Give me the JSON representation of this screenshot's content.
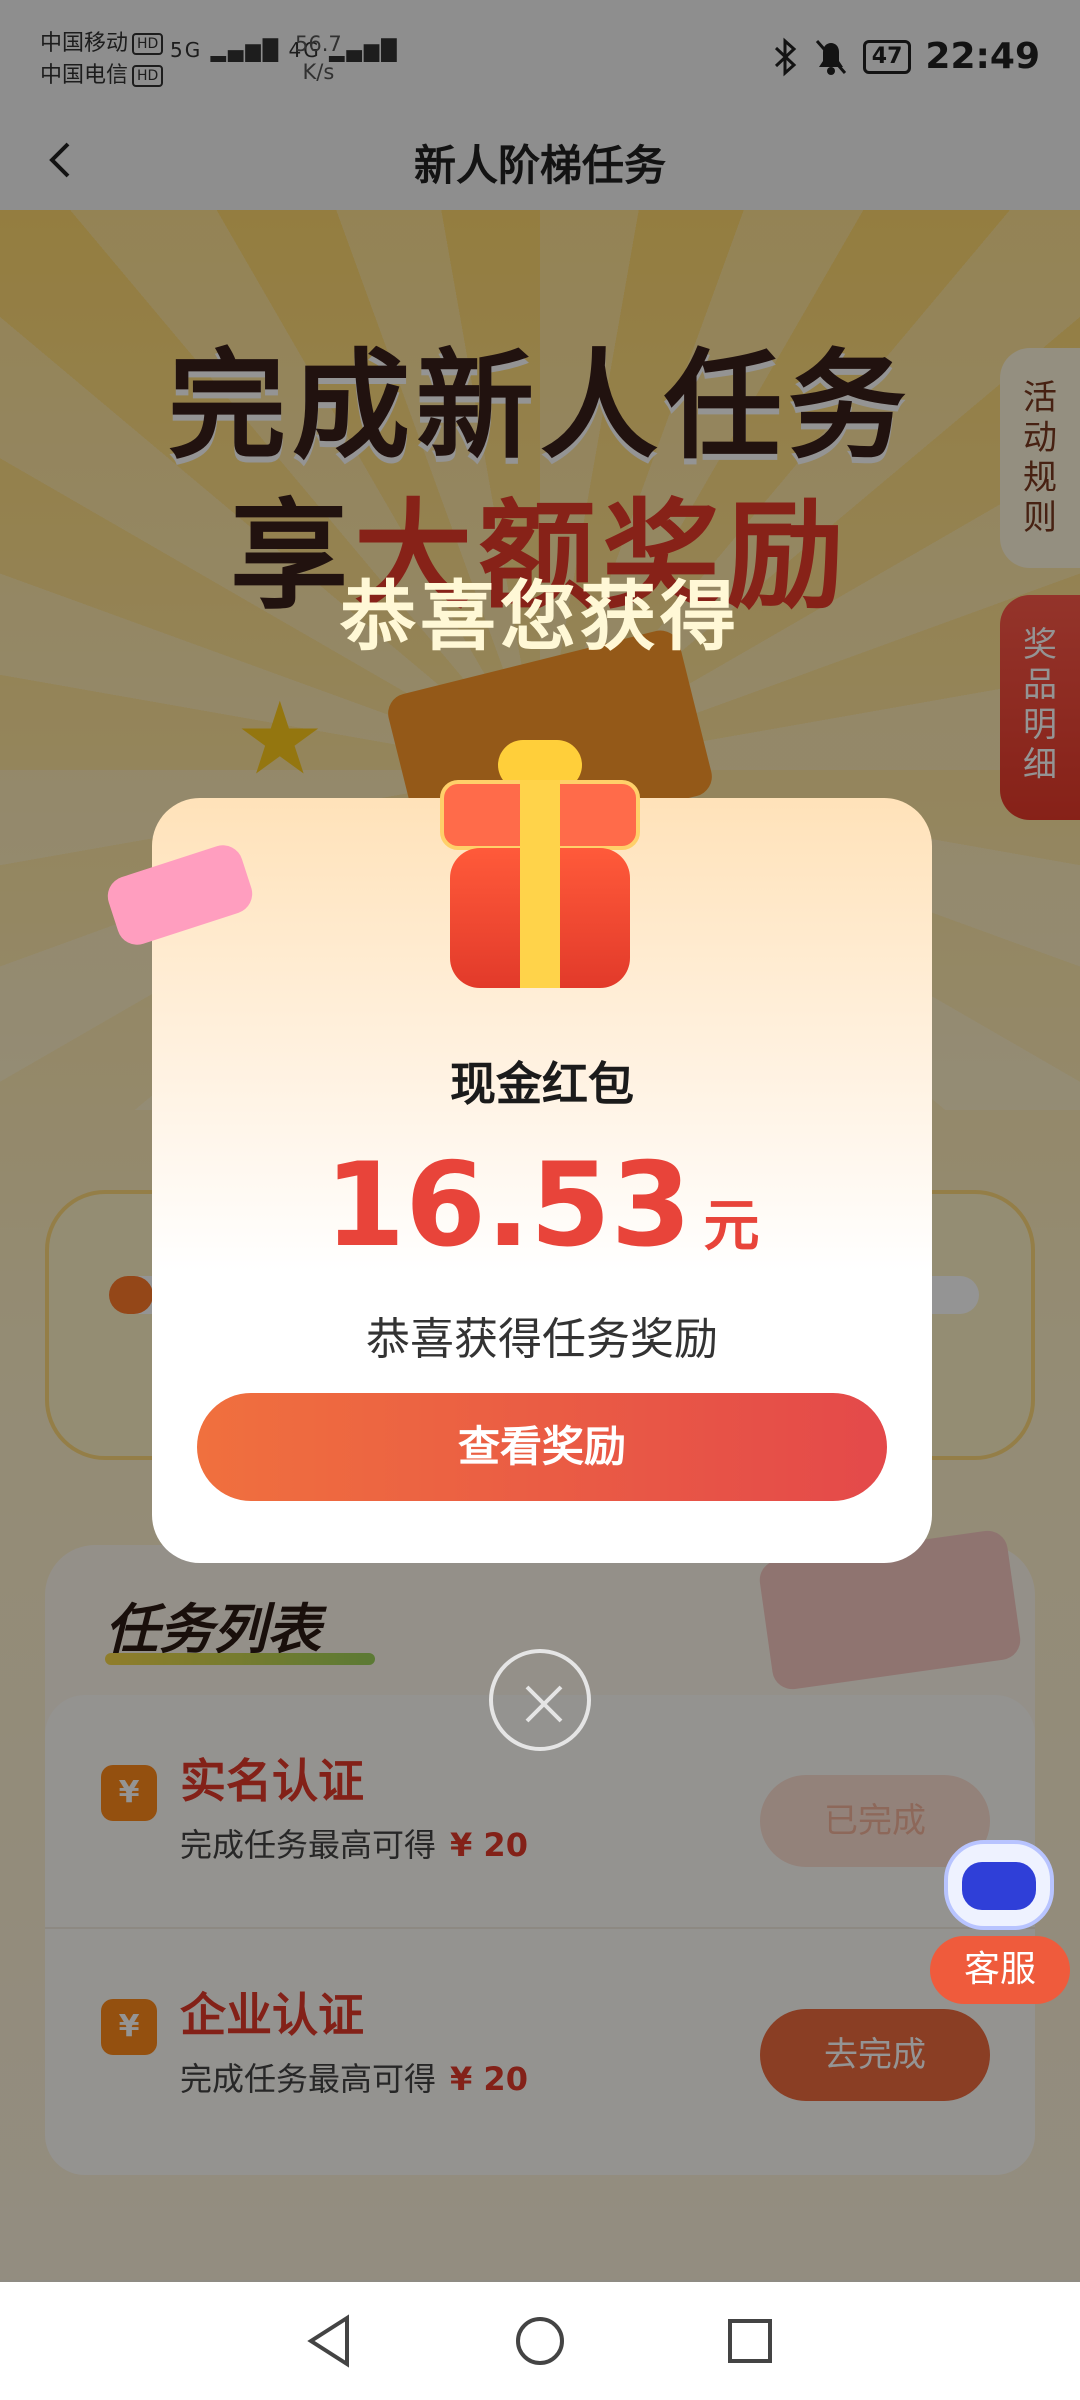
{
  "status_bar": {
    "carrier1": "中国移动",
    "carrier2": "中国电信",
    "hd": "HD",
    "signal1": "5G",
    "signal2": "4G",
    "net_speed_value": "56.7",
    "net_speed_unit": "K/s",
    "battery": "47",
    "time": "22:49",
    "icons": [
      "bluetooth-icon",
      "mute-icon",
      "battery-icon"
    ]
  },
  "nav": {
    "title": "新人阶梯任务",
    "back_icon": "chevron-left-icon"
  },
  "hero": {
    "line1": "完成新人任务",
    "line2_prefix": "享",
    "line2_accent": "大额奖励"
  },
  "side_tabs": {
    "rules": "活动规则",
    "detail": "奖品明细"
  },
  "progress": {
    "fraction": 0.05
  },
  "task_list": {
    "title": "任务列表",
    "items": [
      {
        "name": "实名认证",
        "desc": "完成任务最高可得",
        "reward": "¥ 20",
        "icon": "yen-icon",
        "button": "已完成"
      },
      {
        "name": "企业认证",
        "desc": "完成任务最高可得",
        "reward": "¥ 20",
        "icon": "yen-icon",
        "button": "去完成"
      }
    ]
  },
  "customer_service": {
    "label": "客服",
    "icon": "robot-icon"
  },
  "modal": {
    "heading": "恭喜您获得",
    "reward_type": "现金红包",
    "amount": "16.53",
    "unit": "元",
    "subtitle": "恭喜获得任务奖励",
    "button": "查看奖励",
    "close_icon": "close-icon",
    "gift_icon": "gift-box-icon"
  },
  "bottom_nav": {
    "icons": [
      "back-triangle-icon",
      "home-circle-icon",
      "recents-square-icon"
    ]
  },
  "colors": {
    "accent_red": "#e8443a",
    "button_orange": "#f0703e",
    "hero_dark": "#3a1f1a",
    "page_yellow": "#ffd86e"
  }
}
